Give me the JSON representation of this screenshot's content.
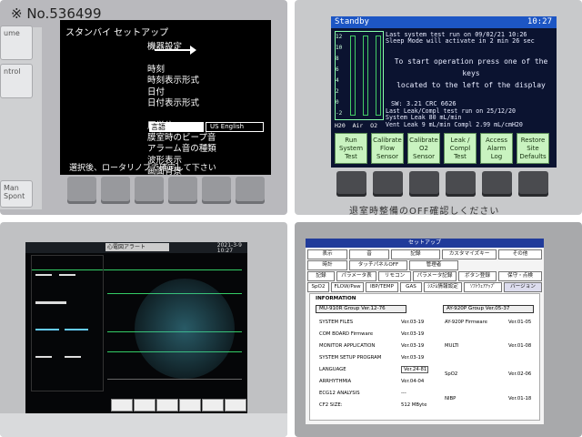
{
  "panel1": {
    "watermark": "※ No.536499",
    "left_buttons": [
      "ume",
      "ntrol",
      "Man\nSpont"
    ],
    "title": "スタンバイ セットアップ",
    "menu": [
      "機器設定",
      "時刻",
      "時刻表示形式",
      "日付",
      "日付表示形式",
      "言語",
      "圧単位",
      "膜室時のビープ音",
      "アラーム音の種類",
      "波形表示",
      "画面背景"
    ],
    "language_selected": "言語",
    "language_option": "US English",
    "footer": "選択後、ロータリノブで確定して下さい"
  },
  "panel2": {
    "bar_title": "Standby",
    "time": "10:27",
    "gauge_ticks": [
      "12",
      "10",
      "8",
      "6",
      "4",
      "2",
      "0",
      "-2"
    ],
    "gauge_labels": [
      "H20",
      "Air",
      "O2"
    ],
    "msg_lines": [
      "Last system test run on    09/02/21 10:26",
      "Sleep Mode will activate in  2 min 26 sec"
    ],
    "instructions": [
      "To start operation press one of the keys",
      "located to the left of the display"
    ],
    "sw": "SW: 3.21         CRC  6626",
    "leak_lines": [
      "Last Leak/Compl test run on  25/12/20",
      "System Leak 80 mL/min",
      "Vent Leak   9 mL/min  Compl  2.99 mL/cmH20"
    ],
    "buttons": [
      {
        "label": "Run\nSystem\nTest"
      },
      {
        "label": "Calibrate\nFlow\nSensor"
      },
      {
        "label": "Calibrate\nO2\nSensor"
      },
      {
        "label": "Leak /\nCompl\nTest"
      },
      {
        "label": "Access\nAlarm\nLog"
      },
      {
        "label": "Restore\nSite\nDefaults"
      }
    ],
    "bottom_text": "退室時整備のOFF確認しください"
  },
  "panel3": {
    "date": "2021-3-9\n10:27",
    "tab_label": "心電図アラート"
  },
  "panel4": {
    "header": "セットアップ",
    "tabs_row1": [
      "表示",
      "音",
      "記録",
      "カスタマイズキー",
      "その他"
    ],
    "tabs_row2": [
      "時計",
      "タッチパネルOFF",
      "管理者"
    ],
    "tabs_row3": [
      "記録",
      "パラメータ表",
      "リモコン",
      "パラメータ記録",
      "ボタン登録",
      "保守・点検"
    ],
    "tabs_row4": [
      "SpO2",
      "FLOW/Paw",
      "IBP/TEMP",
      "GAS",
      "ｼｽﾃﾑ情報設定",
      "ｿﾌﾄｳｪｱｱｯﾌﾟ",
      "バージョン"
    ],
    "info_title": "INFORMATION",
    "group_left": "MU-910R Group  Ver.12-76",
    "group_right": "AY-920P Group  Ver.05-37",
    "rows_left": [
      {
        "k": "SYSTEM FILES",
        "v": "Ver.03-19"
      },
      {
        "k": "COM BOARD Firmware",
        "v": "Ver.03-19"
      },
      {
        "k": "MONITOR APPLICATION",
        "v": "Ver.03-19"
      },
      {
        "k": "SYSTEM SETUP PROGRAM",
        "v": "Ver.03-19"
      },
      {
        "k": "LANGUAGE",
        "v": "Ver.24-81"
      },
      {
        "k": "ARRHYTHMIA",
        "v": "Ver.04-04"
      },
      {
        "k": "ECG12 ANALYSIS",
        "v": "---"
      },
      {
        "k": "CF2 SIZE:",
        "v": "512 MByte"
      }
    ],
    "rows_right": [
      {
        "k": "AY-920P Firmware",
        "v": "Ver.01-05"
      },
      {
        "k": "MULTI",
        "v": "Ver.01-08"
      },
      {
        "k": "SpO2",
        "v": "Ver.02-06"
      },
      {
        "k": "NIBP",
        "v": "Ver.01-18"
      }
    ]
  }
}
